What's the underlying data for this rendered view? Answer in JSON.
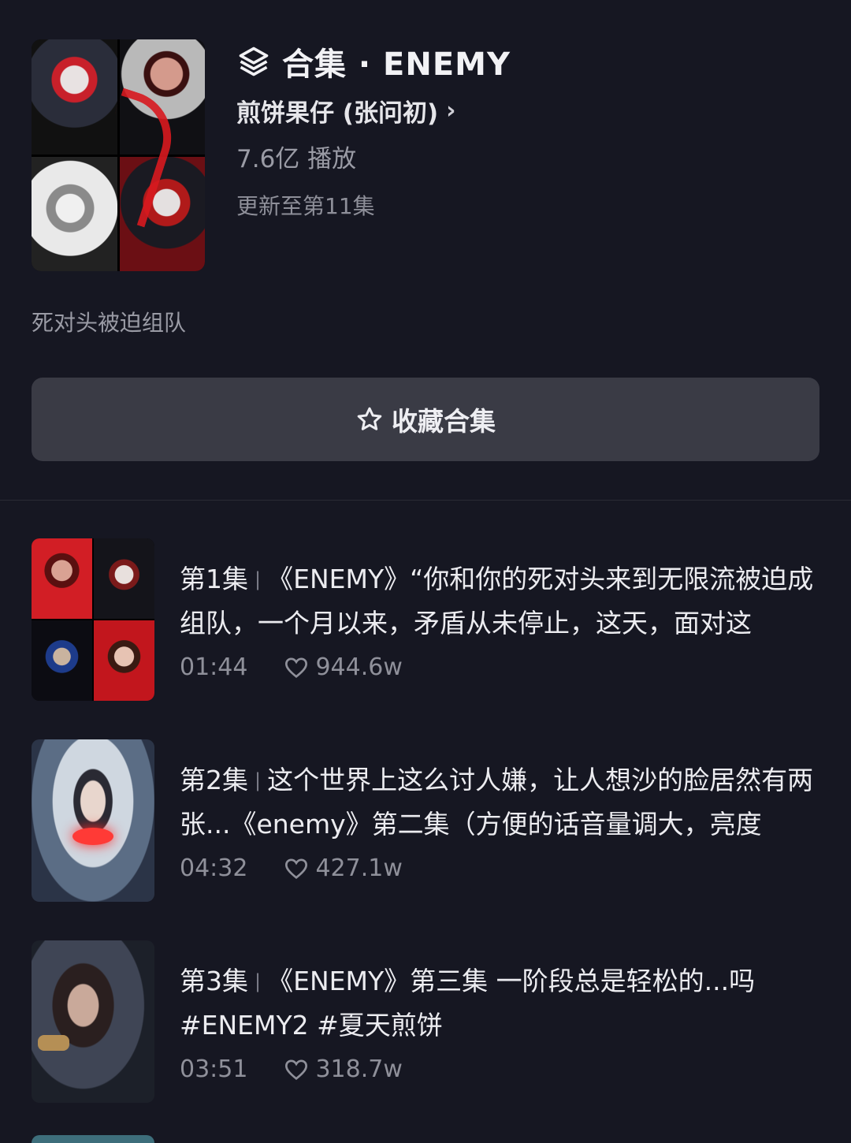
{
  "header": {
    "collection_title": "合集 · ENEMY",
    "author": "煎饼果仔 (张问初)",
    "plays": "7.6亿 播放",
    "update_status": "更新至第11集"
  },
  "description": "死对头被迫组队",
  "collect_button": {
    "label": "收藏合集"
  },
  "episodes": [
    {
      "number": "第1集",
      "title": "《ENEMY》“你和你的死对头来到无限流被迫成组队，一个月以来，矛盾从未停止，这天，面对这",
      "duration": "01:44",
      "likes": "944.6w"
    },
    {
      "number": "第2集",
      "title": "这个世界上这么讨人嫌，让人想沙的脸居然有两张...《enemy》第二集（方便的话音量调大，亮度",
      "duration": "04:32",
      "likes": "427.1w"
    },
    {
      "number": "第3集",
      "title": "《ENEMY》第三集  一阶段总是轻松的...吗 #ENEMY2 #夏天煎饼",
      "duration": "03:51",
      "likes": "318.7w"
    }
  ],
  "icons": {
    "collection": "layers-icon",
    "author_chevron": "chevron-right-icon",
    "collect": "star-outline-icon",
    "likes": "heart-outline-icon"
  },
  "colors": {
    "background": "#161722",
    "button_bg": "#3a3b45",
    "secondary_text": "#9a9ba5"
  }
}
